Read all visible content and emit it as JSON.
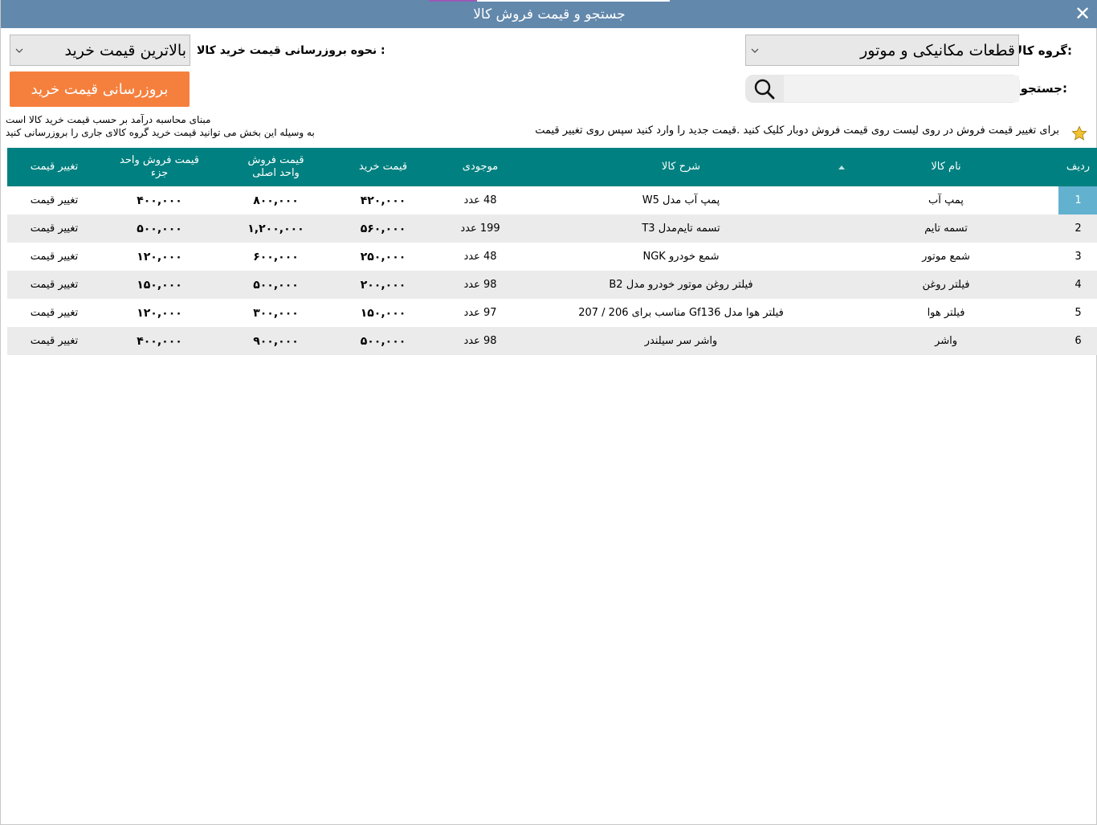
{
  "window": {
    "title": "جستجو و قیمت فروش کالا",
    "close_symbol": "✕"
  },
  "filters": {
    "group_label": "گروه کالا:",
    "group_value": "قطعات مکانیکی و موتور",
    "update_method_label": "نحوه بروزرسانی قیمت خرید کالا :",
    "update_method_value": "بالاترین قیمت خرید",
    "search_label": "جستجو:",
    "search_value": "",
    "search_placeholder": ""
  },
  "update_button": {
    "label": "بروزرسانی قیمت خرید"
  },
  "notes": {
    "line1": "مبنای محاسبه درآمد بر حسب قیمت خرید کالا است",
    "line2": "به وسیله این بخش می توانید قیمت خرید گروه کالای جاری را بروزرسانی کنید",
    "hint": "برای تغییر قیمت فروش در روی لیست روی قیمت فروش دوبار کلیک کنید .قیمت جدید را وارد کنید سپس روی تغییر قیمت"
  },
  "table": {
    "headers": {
      "row": "ردیف",
      "name": "نام کالا",
      "description": "شرح کالا",
      "stock": "موجودی",
      "buy_price": "قیمت خرید",
      "sell_main_1": "قیمت فروش",
      "sell_main_2": "واحد اصلی",
      "sell_part_1": "قیمت فروش واحد",
      "sell_part_2": "جزء",
      "change": "تغییر قیمت"
    },
    "rows": [
      {
        "row": "1",
        "name": "پمپ آب",
        "description": "پمپ آب مدل W5",
        "stock": "48 عدد",
        "buy_price": "۴۲۰,۰۰۰",
        "sell_main": "۸۰۰,۰۰۰",
        "sell_part": "۴۰۰,۰۰۰",
        "change": "تغییر قیمت"
      },
      {
        "row": "2",
        "name": "تسمه تایم",
        "description": "تسمه تایم‌مدل T3",
        "stock": "199 عدد",
        "buy_price": "۵۶۰,۰۰۰",
        "sell_main": "۱,۲۰۰,۰۰۰",
        "sell_part": "۵۰۰,۰۰۰",
        "change": "تغییر قیمت"
      },
      {
        "row": "3",
        "name": "شمع موتور",
        "description": "شمع خودرو NGK",
        "stock": "48 عدد",
        "buy_price": "۲۵۰,۰۰۰",
        "sell_main": "۶۰۰,۰۰۰",
        "sell_part": "۱۲۰,۰۰۰",
        "change": "تغییر قیمت"
      },
      {
        "row": "4",
        "name": "فیلتر روغن",
        "description": "فیلتر روغن موتور خودرو مدل B2",
        "stock": "98 عدد",
        "buy_price": "۲۰۰,۰۰۰",
        "sell_main": "۵۰۰,۰۰۰",
        "sell_part": "۱۵۰,۰۰۰",
        "change": "تغییر قیمت"
      },
      {
        "row": "5",
        "name": "فیلتر هوا",
        "description": "فیلتر هوا مدل Gf136 مناسب برای 206 / 207",
        "stock": "97 عدد",
        "buy_price": "۱۵۰,۰۰۰",
        "sell_main": "۳۰۰,۰۰۰",
        "sell_part": "۱۲۰,۰۰۰",
        "change": "تغییر قیمت"
      },
      {
        "row": "6",
        "name": "واشر",
        "description": "واشر سر سیلندر",
        "stock": "98 عدد",
        "buy_price": "۵۰۰,۰۰۰",
        "sell_main": "۹۰۰,۰۰۰",
        "sell_part": "۴۰۰,۰۰۰",
        "change": "تغییر قیمت"
      }
    ]
  },
  "colors": {
    "titlebar": "#6288ac",
    "header": "#008080",
    "button": "#f5803e",
    "selected_row": "#62b1cf",
    "star": "#f2c230"
  },
  "icons": {
    "search": "search-icon",
    "star": "star-icon",
    "dropdown": "chevron-down-icon",
    "close": "close-icon"
  }
}
